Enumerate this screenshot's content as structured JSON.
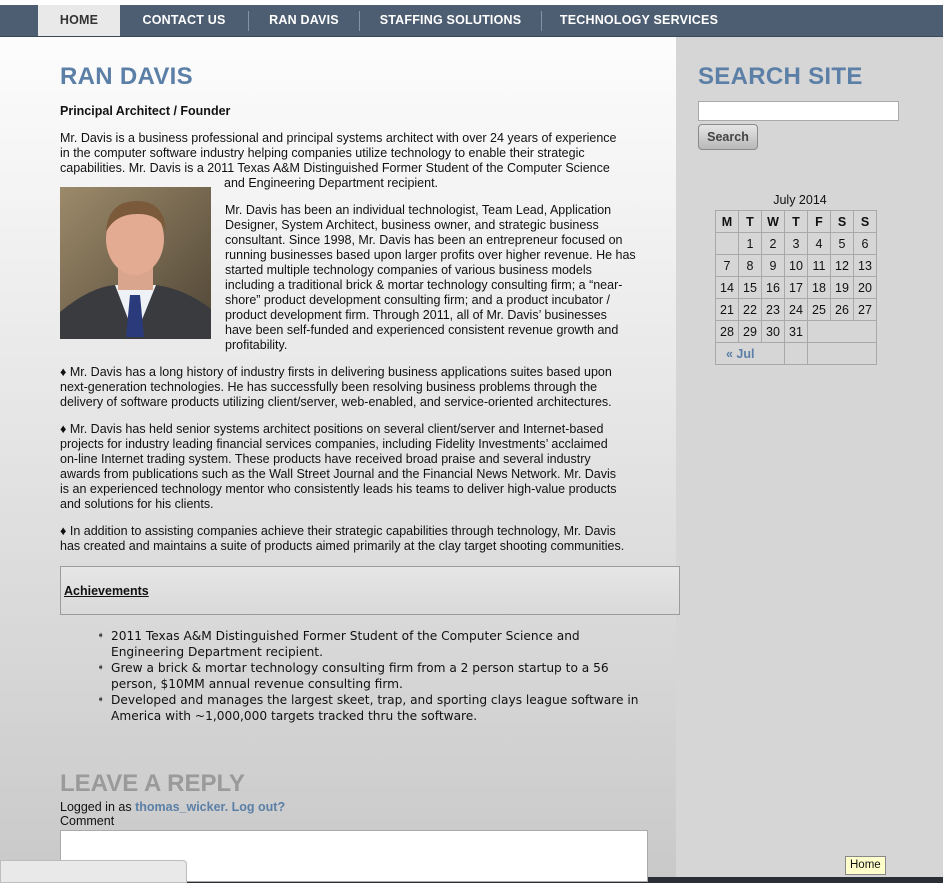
{
  "nav": {
    "items": [
      "HOME",
      "CONTACT US",
      "RAN DAVIS",
      "STAFFING SOLUTIONS",
      "TECHNOLOGY SERVICES"
    ],
    "active": "HOME"
  },
  "main": {
    "title": "RAN DAVIS",
    "subtitle": "Principal Architect / Founder",
    "intro_lines": [
      "Mr. Davis is a business professional and principal systems architect with over 24 years of experience",
      "in the computer software industry helping companies utilize technology to enable their strategic",
      "capabilities.   Mr. Davis is a 2011 Texas A&M Distinguished Former Student of the Computer Science",
      "and Engineering Department recipient."
    ],
    "photo_alt": "Portrait photo",
    "bio_lines": [
      "Mr. Davis has been an individual technologist, Team Lead, Application",
      "Designer, System Architect, business owner, and strategic business",
      "consultant.  Since 1998, Mr. Davis has been an entrepreneur focused on",
      "running businesses based upon larger profits over higher revenue.  He has",
      "started multiple technology companies of various business models",
      "including a traditional brick & mortar technology consulting firm; a “near-",
      "shore” product development consulting firm; and a product incubator /",
      "product development firm.  Through 2011, all of Mr. Davis’ businesses",
      "have been self-funded and experienced consistent revenue growth and",
      "profitability."
    ],
    "para2_lines": [
      "♦  Mr. Davis has a long history of industry firsts in delivering business applications suites based upon",
      "next-generation technologies. He has successfully been resolving business problems through the",
      "delivery of software products utilizing client/server, web-enabled, and service-oriented architectures."
    ],
    "para3_lines": [
      "♦  Mr. Davis has held senior systems architect positions on several client/server and Internet-based",
      "projects for industry leading financial services companies, including Fidelity Investments’ acclaimed",
      "on-line Internet trading system. These products have received broad praise and several industry",
      "awards from publications such as the Wall Street Journal and the Financial News Network. Mr. Davis",
      "is an experienced technology mentor who consistently leads his teams to deliver high-value products",
      "and solutions for his clients."
    ],
    "para4_lines": [
      "♦  In addition to assisting companies achieve their strategic capabilities through technology, Mr. Davis",
      "has created and maintains a suite of products aimed primarily at the clay target shooting communities."
    ],
    "achievements_heading": "Achievements",
    "achievements": [
      [
        "2011 Texas A&M Distinguished Former Student of the Computer Science and",
        "Engineering Department recipient."
      ],
      [
        "Grew a brick & mortar technology consulting firm from a 2 person startup to a 56",
        "person, $10MM annual revenue consulting firm."
      ],
      [
        "Developed and manages the largest skeet, trap, and sporting clays league software in",
        "America with ~1,000,000 targets tracked thru the software."
      ]
    ]
  },
  "reply": {
    "title": "LEAVE A REPLY",
    "logged_prefix": "Logged in as ",
    "user": "thomas_wicker",
    "logout": "Log out?",
    "comment_label": "Comment"
  },
  "sidebar": {
    "search_title": "SEARCH SITE",
    "search_value": "",
    "search_button": "Search",
    "calendar": {
      "caption": "July 2014",
      "headers": [
        "M",
        "T",
        "W",
        "T",
        "F",
        "S",
        "S"
      ],
      "weeks": [
        [
          "",
          "1",
          "2",
          "3",
          "4",
          "5",
          "6"
        ],
        [
          "7",
          "8",
          "9",
          "10",
          "11",
          "12",
          "13"
        ],
        [
          "14",
          "15",
          "16",
          "17",
          "18",
          "19",
          "20"
        ],
        [
          "21",
          "22",
          "23",
          "24",
          "25",
          "26",
          "27"
        ],
        [
          "28",
          "29",
          "30",
          "31",
          "",
          "",
          ""
        ]
      ],
      "prev_link": "« Jul"
    }
  },
  "tooltip": "Home"
}
